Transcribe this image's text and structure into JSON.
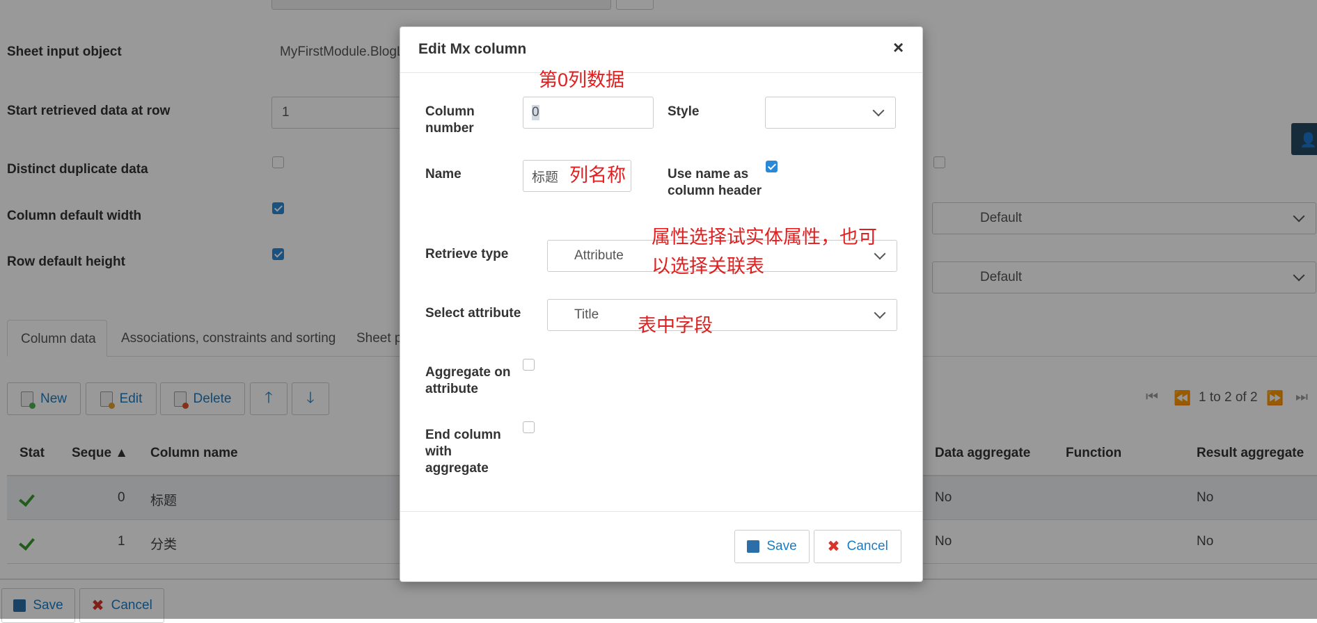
{
  "background": {
    "form": {
      "sheet_input_object_label": "Sheet input object",
      "sheet_input_object_value": "MyFirstModule.BlogL",
      "start_row_label": "Start retrieved data at row",
      "start_row_value": "1",
      "distinct_duplicate_label": "Distinct duplicate data",
      "column_default_width_label": "Column default width",
      "row_default_height_label": "Row default height",
      "default_select_1": "Default",
      "default_select_2": "Default"
    },
    "tabs": [
      "Column data",
      "Associations, constraints and sorting",
      "Sheet p"
    ],
    "toolbar": {
      "new_label": "New",
      "edit_label": "Edit",
      "delete_label": "Delete",
      "paging_text": "1 to 2 of 2"
    },
    "table": {
      "headers": {
        "stat": "Stat",
        "seque": "Seque ▲",
        "column_name": "Column name",
        "data_aggregate": "Data aggregate",
        "function": "Function",
        "result_aggregate": "Result aggregate"
      },
      "rows": [
        {
          "seq": "0",
          "name": "标题",
          "data_aggregate": "No",
          "result_aggregate": "No"
        },
        {
          "seq": "1",
          "name": "分类",
          "data_aggregate": "No",
          "result_aggregate": "No"
        }
      ]
    },
    "footer": {
      "save_label": "Save",
      "cancel_label": "Cancel"
    }
  },
  "modal": {
    "title": "Edit Mx column",
    "close_glyph": "×",
    "column_number_label": "Column number",
    "column_number_value": "0",
    "style_label": "Style",
    "name_label": "Name",
    "name_value": "标题",
    "use_name_label": "Use name as column header",
    "retrieve_type_label": "Retrieve type",
    "retrieve_type_value": "Attribute",
    "select_attribute_label": "Select attribute",
    "select_attribute_value": "Title",
    "aggregate_label": "Aggregate on attribute",
    "end_column_label": "End column with aggregate",
    "save_label": "Save",
    "cancel_label": "Cancel"
  },
  "annotations": {
    "col0": "第0列数据",
    "colname": "列名称",
    "attr_line1": "属性选择试实体属性，也可",
    "attr_line2": "以选择关联表",
    "field": "表中字段"
  },
  "colors": {
    "accent": "#1b7cc4",
    "checkbox": "#2a88d8",
    "annotation": "#e02020",
    "check_green": "#3a9a2e",
    "cancel_red": "#d9342b"
  }
}
